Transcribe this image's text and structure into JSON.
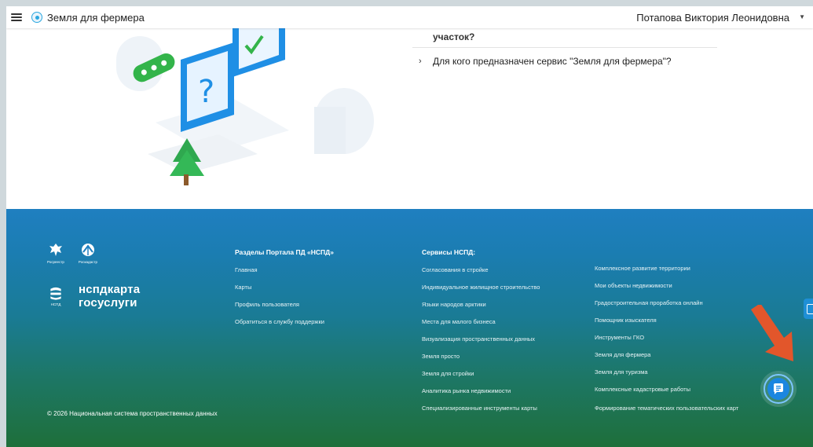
{
  "header": {
    "app_title": "Земля для фермера",
    "user_name": "Потапова Виктория Леонидовна"
  },
  "faq": {
    "partial_item": "участок?",
    "item": "Для кого предназначен сервис \"Земля для фермера\"?"
  },
  "footer": {
    "logo_rosreestr": "Росреестр",
    "logo_roskadastr": "Роскадастр",
    "nspd_caption": "НСПД",
    "nspd_brand_line1": "нспдкарта",
    "nspd_brand_line2": "госуслуги",
    "copyright": "© 2026 Национальная система пространственных данных",
    "sections": {
      "title": "Разделы Портала ПД «НСПД»",
      "links": [
        "Главная",
        "Карты",
        "Профиль пользователя",
        "Обратиться в службу поддержки"
      ]
    },
    "services": {
      "title": "Сервисы НСПД:",
      "col1": [
        "Согласования в стройке",
        "Индивидуальное жилищное строительство",
        "Языки народов арктики",
        "Места для малого бизнеса",
        "Визуализация пространственных данных",
        "Земля просто",
        "Земля для стройки",
        "Аналитика рынка недвижимости",
        "Специализированные инструменты карты"
      ],
      "col2": [
        "Комплексное развитие территории",
        "Мои объекты недвижимости",
        "Градостроительная проработка онлайн",
        "Помощник изыскателя",
        "Инструменты ГКО",
        "Земля для фермера",
        "Земля для туризма",
        "Комплексные кадастровые работы",
        "Формирование тематических пользовательских карт"
      ]
    }
  },
  "colors": {
    "accent": "#1b86e0",
    "arrow": "#e2562b"
  }
}
